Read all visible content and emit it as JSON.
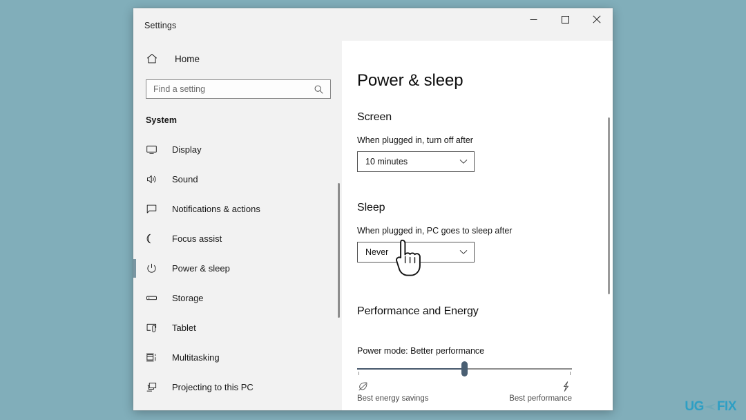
{
  "desktop": {
    "background_color": "#81aeba"
  },
  "window": {
    "title": "Settings",
    "controls": {
      "minimize": "minimize-icon",
      "maximize": "maximize-icon",
      "close": "close-icon"
    }
  },
  "sidebar": {
    "home": {
      "label": "Home",
      "icon": "home-icon"
    },
    "search": {
      "placeholder": "Find a setting",
      "value": "",
      "icon": "search-icon"
    },
    "section_title": "System",
    "items": [
      {
        "label": "Display",
        "icon": "monitor-icon",
        "active": false
      },
      {
        "label": "Sound",
        "icon": "speaker-icon",
        "active": false
      },
      {
        "label": "Notifications & actions",
        "icon": "chat-bubble-icon",
        "active": false
      },
      {
        "label": "Focus assist",
        "icon": "moon-icon",
        "active": false
      },
      {
        "label": "Power & sleep",
        "icon": "power-icon",
        "active": true
      },
      {
        "label": "Storage",
        "icon": "drive-icon",
        "active": false
      },
      {
        "label": "Tablet",
        "icon": "tablet-icon",
        "active": false
      },
      {
        "label": "Multitasking",
        "icon": "multitasking-icon",
        "active": false
      },
      {
        "label": "Projecting to this PC",
        "icon": "project-screen-icon",
        "active": false
      }
    ]
  },
  "main": {
    "page_title": "Power & sleep",
    "screen": {
      "heading": "Screen",
      "field_label": "When plugged in, turn off after",
      "dropdown_value": "10 minutes",
      "dropdown_icon": "chevron-down-icon"
    },
    "sleep": {
      "heading": "Sleep",
      "field_label": "When plugged in, PC goes to sleep after",
      "dropdown_value": "Never",
      "dropdown_icon": "chevron-down-icon"
    },
    "performance": {
      "heading": "Performance and Energy",
      "power_mode_label": "Power mode: Better performance",
      "slider": {
        "position_percent": 50,
        "left_label": "Best energy savings",
        "left_icon": "leaf-icon",
        "right_label": "Best performance",
        "right_icon": "lightning-bolt-icon",
        "fill_color": "#46576b",
        "track_color": "#8c8c8c"
      }
    }
  },
  "watermark": {
    "part1": "U",
    "part2": "G",
    "part3": "FIX",
    "color": "#2e9fc4"
  }
}
